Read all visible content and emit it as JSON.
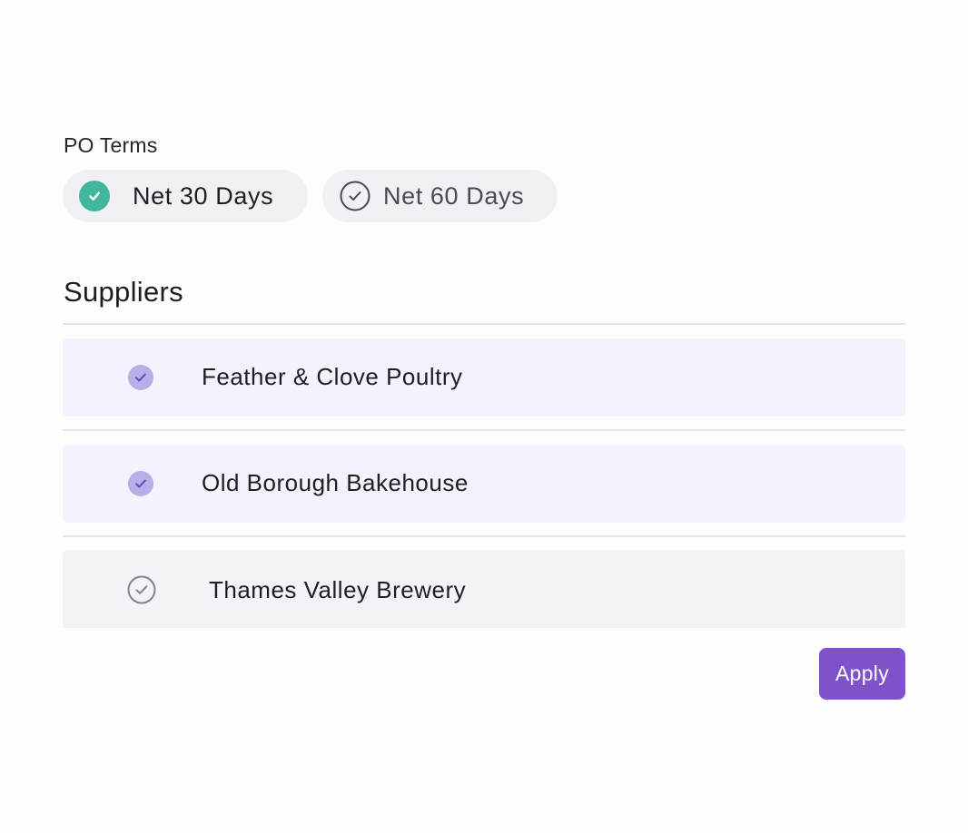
{
  "po_terms": {
    "label": "PO Terms",
    "options": [
      {
        "label": "Net 30 Days",
        "selected": true
      },
      {
        "label": "Net 60 Days",
        "selected": false
      }
    ]
  },
  "suppliers": {
    "title": "Suppliers",
    "items": [
      {
        "label": "Feather & Clove Poultry",
        "checked": true
      },
      {
        "label": "Old Borough Bakehouse",
        "checked": true
      },
      {
        "label": "Thames Valley Brewery",
        "checked": false
      }
    ]
  },
  "apply_label": "Apply",
  "colors": {
    "selected_term": "#3fb79a",
    "checked_supplier": "#b9aeea",
    "checkmark": "#5f47c2",
    "apply_button": "#7e52c9"
  },
  "icons": {
    "selected_term": "check-circle-filled-icon",
    "unselected_term": "check-circle-outline-icon",
    "checked_supplier": "check-circle-filled-icon",
    "unchecked_supplier": "check-circle-outline-icon"
  }
}
